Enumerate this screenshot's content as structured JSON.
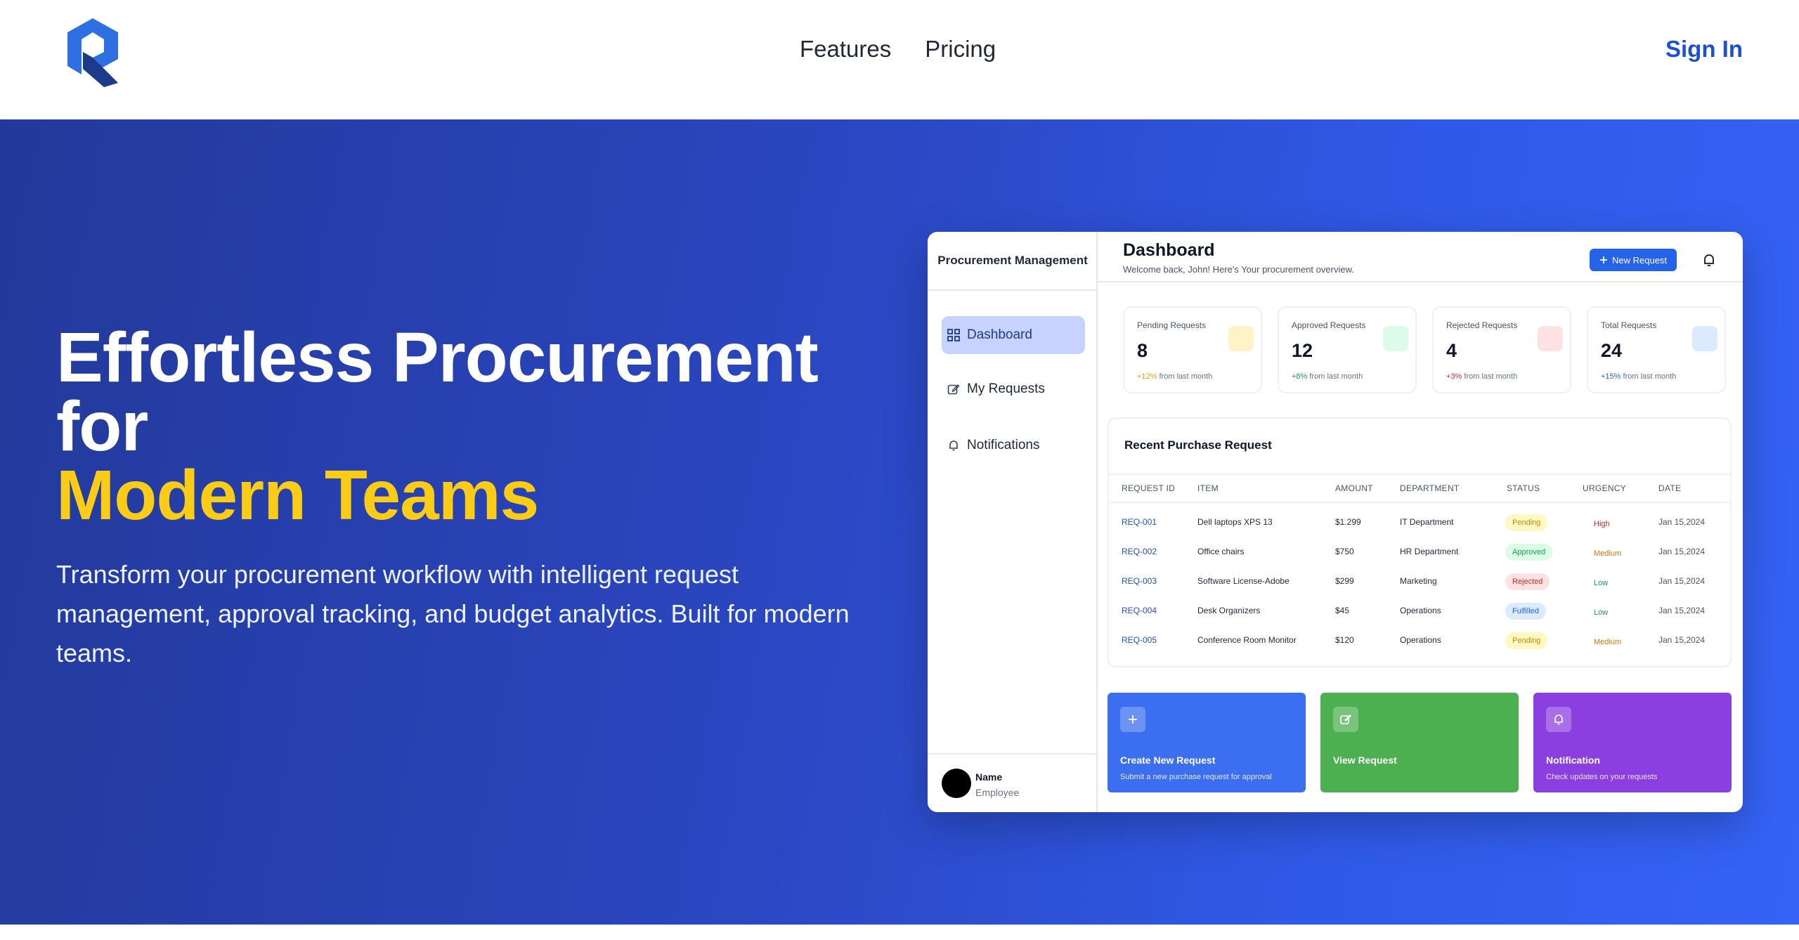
{
  "nav": {
    "links": [
      "Features",
      "Pricing"
    ],
    "sign_in": "Sign In"
  },
  "hero": {
    "title_line1": "Effortless Procurement for",
    "title_line2": "Modern Teams",
    "subtitle": "Transform your procurement workflow with intelligent request management, approval tracking, and budget analytics. Built for modern teams."
  },
  "mockup": {
    "sidebar": {
      "brand": "Procurement Management",
      "items": [
        {
          "label": "Dashboard",
          "icon": "grid-icon",
          "active": true
        },
        {
          "label": "My Requests",
          "icon": "edit-icon",
          "active": false
        },
        {
          "label": "Notifications",
          "icon": "bell-icon",
          "active": false
        }
      ],
      "user": {
        "name": "Name",
        "role": "Employee"
      }
    },
    "header": {
      "title": "Dashboard",
      "welcome": "Welcome back, John! Here's Your procurement overview.",
      "new_request": "New Request"
    },
    "stats": [
      {
        "label": "Pending Requests",
        "value": "8",
        "pct": "+12%",
        "trend": "from last month",
        "color": "#fef3c7",
        "pct_color": "#f59e0b"
      },
      {
        "label": "Approved Requests",
        "value": "12",
        "pct": "+8%",
        "trend": "from last month",
        "color": "#dcfce7",
        "pct_color": "#16a34a"
      },
      {
        "label": "Rejected Requests",
        "value": "4",
        "pct": "+3%",
        "trend": "from last month",
        "color": "#fee2e2",
        "pct_color": "#dc2626"
      },
      {
        "label": "Total Requests",
        "value": "24",
        "pct": "+15%",
        "trend": "from last month",
        "color": "#dbeafe",
        "pct_color": "#2563eb"
      }
    ],
    "table": {
      "title": "Recent Purchase Request",
      "headers": [
        "REQUEST ID",
        "ITEM",
        "AMOUNT",
        "DEPARTMENT",
        "STATUS",
        "URGENCY",
        "DATE"
      ],
      "rows": [
        {
          "id": "REQ-001",
          "item": "Dell laptops XPS 13",
          "amount": "$1.299",
          "dept": "IT Department",
          "status": "Pending",
          "urgency": "High",
          "date": "Jan 15,2024"
        },
        {
          "id": "REQ-002",
          "item": "Office chairs",
          "amount": "$750",
          "dept": "HR Department",
          "status": "Approved",
          "urgency": "Medium",
          "date": "Jan 15,2024"
        },
        {
          "id": "REQ-003",
          "item": "Software License-Adobe",
          "amount": "$299",
          "dept": "Marketing",
          "status": "Rejected",
          "urgency": "Low",
          "date": "Jan 15,2024"
        },
        {
          "id": "REQ-004",
          "item": "Desk Organizers",
          "amount": "$45",
          "dept": "Operations",
          "status": "Fulfilled",
          "urgency": "Low",
          "date": "Jan 15,2024"
        },
        {
          "id": "REQ-005",
          "item": "Conference Room Monitor",
          "amount": "$120",
          "dept": "Operations",
          "status": "Pending",
          "urgency": "Medium",
          "date": "Jan 15,2024"
        }
      ]
    },
    "actions": [
      {
        "title": "Create New Request",
        "desc": "Submit a new purchase request for approval",
        "color": "#3b6ef0",
        "icon": "plus-icon"
      },
      {
        "title": "View Request",
        "desc": "",
        "color": "#4caf50",
        "icon": "edit-icon"
      },
      {
        "title": "Notification",
        "desc": "Check updates on your requests",
        "color": "#8b3fe0",
        "icon": "bell-icon"
      }
    ],
    "colors": {
      "status": {
        "Pending": {
          "bg": "#fef9c3",
          "fg": "#ca8a04"
        },
        "Approved": {
          "bg": "#dcfce7",
          "fg": "#16a34a"
        },
        "Rejected": {
          "bg": "#fee2e2",
          "fg": "#dc2626"
        },
        "Fulfilled": {
          "bg": "#dbeafe",
          "fg": "#2563eb"
        }
      },
      "urgency": {
        "High": "#dc2626",
        "Medium": "#d97706",
        "Low": "#16a34a"
      }
    }
  }
}
